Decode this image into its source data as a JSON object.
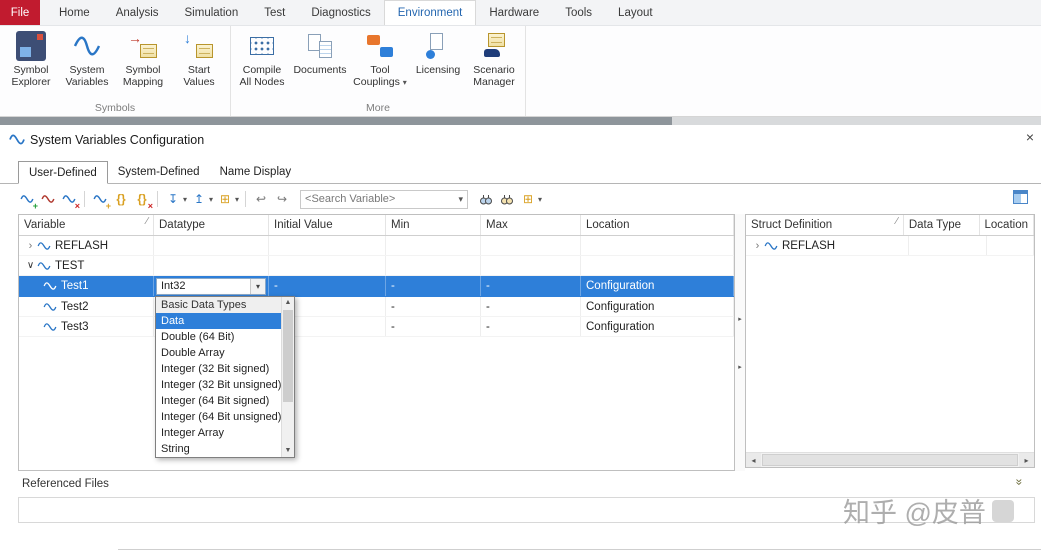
{
  "icons": {
    "caret_down": "▾",
    "close": "×",
    "chevron_collapsed": "›",
    "chevron_expanded": "∨",
    "sort_asc": "∕",
    "scroll_up": "▲",
    "scroll_down": "▼",
    "scroll_left": "◂",
    "scroll_right": "▸",
    "collapse_section": "»",
    "splitter_arrow": "▸",
    "undo": "↩",
    "redo": "↪",
    "import": "↧",
    "export": "↥",
    "grid": "⊞",
    "braces": "{}",
    "plus": "+",
    "x": "×",
    "arrow_right": "→",
    "arrow_down": "↓"
  },
  "ribbon": {
    "file_tab": "File",
    "tabs": [
      {
        "label": "Home"
      },
      {
        "label": "Analysis"
      },
      {
        "label": "Simulation"
      },
      {
        "label": "Test"
      },
      {
        "label": "Diagnostics"
      },
      {
        "label": "Environment",
        "active": true
      },
      {
        "label": "Hardware"
      },
      {
        "label": "Tools"
      },
      {
        "label": "Layout"
      }
    ],
    "groups": {
      "symbols": "Symbols",
      "more": "More"
    },
    "buttons": [
      {
        "label": "Symbol Explorer"
      },
      {
        "label": "System Variables"
      },
      {
        "label": "Symbol Mapping"
      },
      {
        "label": "Start Values"
      },
      {
        "label": "Compile All Nodes"
      },
      {
        "label": "Documents"
      },
      {
        "label": "Tool Couplings"
      },
      {
        "label": "Licensing"
      },
      {
        "label": "Scenario Manager"
      }
    ]
  },
  "panel": {
    "title": "System Variables Configuration",
    "tabs": [
      {
        "label": "User-Defined",
        "active": true
      },
      {
        "label": "System-Defined"
      },
      {
        "label": "Name Display"
      }
    ],
    "search_placeholder": "<Search Variable>"
  },
  "grid": {
    "columns": [
      "Variable",
      "Datatype",
      "Initial Value",
      "Min",
      "Max",
      "Location"
    ],
    "rows": [
      {
        "name": "REFLASH",
        "type": "group",
        "expanded": false
      },
      {
        "name": "TEST",
        "type": "group",
        "expanded": true
      },
      {
        "name": "Test1",
        "datatype": "Int32",
        "initial": "-",
        "min": "-",
        "max": "-",
        "location": "Configuration",
        "selected": true
      },
      {
        "name": "Test2",
        "min": "-",
        "max": "-",
        "location": "Configuration"
      },
      {
        "name": "Test3",
        "min": "-",
        "max": "-",
        "location": "Configuration"
      }
    ]
  },
  "dropdown": {
    "header": "Basic Data Types",
    "selected": "Data",
    "items": [
      "Data",
      "Double (64 Bit)",
      "Double Array",
      "Integer (32 Bit signed)",
      "Integer (32 Bit unsigned)",
      "Integer (64 Bit signed)",
      "Integer (64 Bit unsigned)",
      "Integer Array",
      "String"
    ]
  },
  "struct_panel": {
    "columns": [
      "Struct Definition",
      "Data Type",
      "Location"
    ],
    "rows": [
      {
        "name": "REFLASH",
        "expanded": false
      }
    ]
  },
  "referenced_files": {
    "label": "Referenced Files"
  },
  "watermark": {
    "text": "知乎 @皮普"
  },
  "colors": {
    "selection": "#2e7fd9",
    "file_tab_red": "#c11b2f",
    "active_tab_text": "#2567b0"
  }
}
